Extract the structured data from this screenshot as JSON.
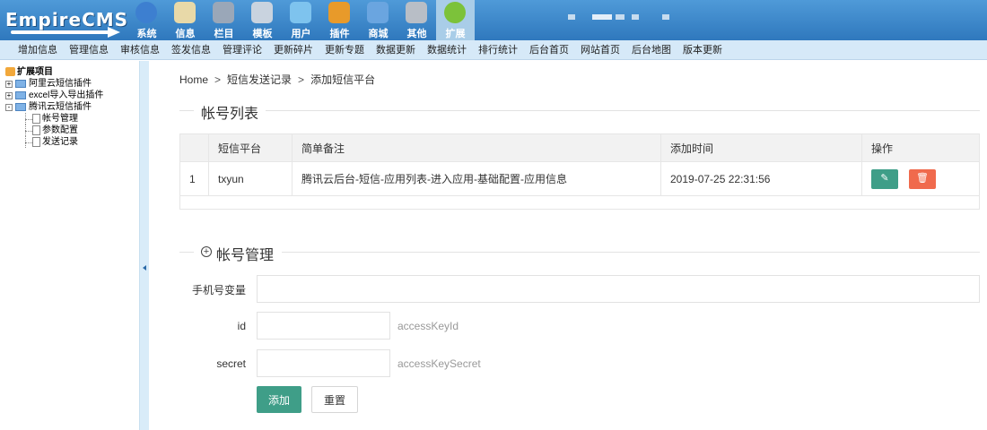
{
  "header": {
    "logo_text": "EmpireCMS",
    "nav": [
      {
        "label": "系统",
        "icon": "globe-icon",
        "color": "#3d7fd0"
      },
      {
        "label": "信息",
        "icon": "document-pencil-icon",
        "color": "#e8d9a8"
      },
      {
        "label": "栏目",
        "icon": "folder-icon",
        "color": "#9aa7b8"
      },
      {
        "label": "模板",
        "icon": "template-window-icon",
        "color": "#c9d3df"
      },
      {
        "label": "用户",
        "icon": "user-icon",
        "color": "#7ec3ee"
      },
      {
        "label": "插件",
        "icon": "tools-icon",
        "color": "#e89a2a"
      },
      {
        "label": "商城",
        "icon": "credit-card-icon",
        "color": "#6aa5e0"
      },
      {
        "label": "其他",
        "icon": "gear-icon",
        "color": "#b8bec6"
      },
      {
        "label": "扩展",
        "icon": "plus-circle-icon",
        "color": "#7cc23a",
        "active": true
      }
    ]
  },
  "submenu": [
    "增加信息",
    "管理信息",
    "审核信息",
    "签发信息",
    "管理评论",
    "更新碎片",
    "更新专题",
    "数据更新",
    "数据统计",
    "排行统计",
    "后台首页",
    "网站首页",
    "后台地图",
    "版本更新"
  ],
  "sidebar": {
    "root": "扩展项目",
    "nodes": [
      {
        "label": "阿里云短信插件",
        "toggle": "+"
      },
      {
        "label": "excel导入导出插件",
        "toggle": "+"
      },
      {
        "label": "腾讯云短信插件",
        "toggle": "-"
      }
    ],
    "leaves": [
      "帐号管理",
      "参数配置",
      "发送记录"
    ]
  },
  "breadcrumb": [
    "Home",
    "短信发送记录",
    "添加短信平台"
  ],
  "breadcrumb_sep": ">",
  "accounts": {
    "title": "帐号列表",
    "columns": [
      "",
      "短信平台",
      "简单备注",
      "添加时间",
      "操作"
    ],
    "rows": [
      {
        "index": "1",
        "platform": "txyun",
        "note": "腾讯云后台-短信-应用列表-进入应用-基础配置-应用信息",
        "time": "2019-07-25 22:31:56"
      }
    ],
    "edit_icon": "pencil-icon",
    "delete_icon": "trash-icon"
  },
  "form": {
    "title": "帐号管理",
    "phone_label": "手机号变量",
    "phone_value": "",
    "id_label": "id",
    "id_value": "",
    "id_hint": "accessKeyId",
    "secret_label": "secret",
    "secret_value": "",
    "secret_hint": "accessKeySecret",
    "add_label": "添加",
    "reset_label": "重置"
  },
  "colors": {
    "header_top": "#4f9ad8",
    "header_bottom": "#2f78bd",
    "submenu_bg": "#d6e9f8",
    "primary_button": "#3f9e88",
    "danger_button": "#f06a4d"
  }
}
